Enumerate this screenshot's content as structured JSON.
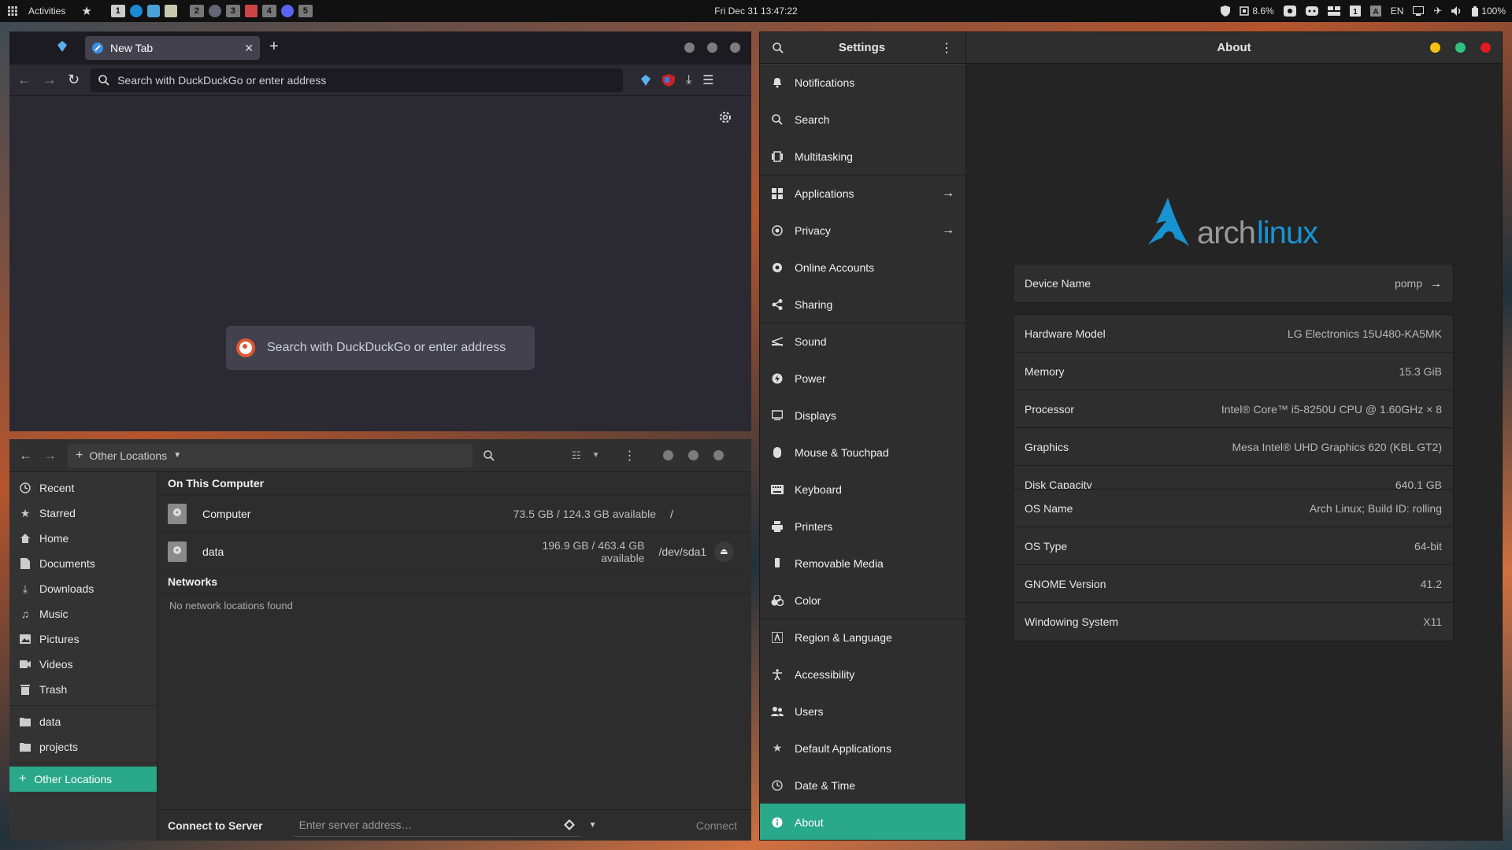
{
  "topbar": {
    "activities": "Activities",
    "workspaces": [
      "1",
      "2",
      "3",
      "4",
      "5"
    ],
    "clock": "Fri Dec 31  13:47:22",
    "cpu": "8.6%",
    "lang": "EN",
    "battery": "100%"
  },
  "browser": {
    "tab_title": "New Tab",
    "url_placeholder": "Search with DuckDuckGo or enter address",
    "center_search": "Search with DuckDuckGo or enter address"
  },
  "files": {
    "path": "Other Locations",
    "sidebar": [
      {
        "label": "Recent",
        "icon": "clock-icon"
      },
      {
        "label": "Starred",
        "icon": "star-icon"
      },
      {
        "label": "Home",
        "icon": "home-icon"
      },
      {
        "label": "Documents",
        "icon": "documents-icon"
      },
      {
        "label": "Downloads",
        "icon": "download-icon"
      },
      {
        "label": "Music",
        "icon": "music-icon"
      },
      {
        "label": "Pictures",
        "icon": "pictures-icon"
      },
      {
        "label": "Videos",
        "icon": "videos-icon"
      },
      {
        "label": "Trash",
        "icon": "trash-icon"
      }
    ],
    "bookmarks": [
      {
        "label": "data",
        "icon": "folder-icon"
      },
      {
        "label": "projects",
        "icon": "folder-icon"
      }
    ],
    "other_locations": "Other Locations",
    "on_this_computer": "On This Computer",
    "drives": [
      {
        "name": "Computer",
        "space": "73.5 GB / 124.3 GB available",
        "mount": "/"
      },
      {
        "name": "data",
        "space": "196.9 GB / 463.4 GB available",
        "mount": "/dev/sda1"
      }
    ],
    "networks": "Networks",
    "no_networks": "No network locations found",
    "connect_label": "Connect to Server",
    "connect_placeholder": "Enter server address…",
    "connect_button": "Connect"
  },
  "settings": {
    "title": "Settings",
    "panel_title": "About",
    "nav": [
      {
        "label": "Notifications",
        "icon": "bell-icon"
      },
      {
        "label": "Search",
        "icon": "search-icon"
      },
      {
        "label": "Multitasking",
        "icon": "multitasking-icon"
      },
      {
        "label": "Applications",
        "icon": "applications-icon",
        "arrow": true
      },
      {
        "label": "Privacy",
        "icon": "privacy-icon",
        "arrow": true
      },
      {
        "label": "Online Accounts",
        "icon": "online-accounts-icon"
      },
      {
        "label": "Sharing",
        "icon": "share-icon"
      },
      {
        "label": "Sound",
        "icon": "sound-icon"
      },
      {
        "label": "Power",
        "icon": "power-icon"
      },
      {
        "label": "Displays",
        "icon": "display-icon"
      },
      {
        "label": "Mouse & Touchpad",
        "icon": "mouse-icon"
      },
      {
        "label": "Keyboard",
        "icon": "keyboard-icon"
      },
      {
        "label": "Printers",
        "icon": "printer-icon"
      },
      {
        "label": "Removable Media",
        "icon": "usb-icon"
      },
      {
        "label": "Color",
        "icon": "color-icon"
      },
      {
        "label": "Region & Language",
        "icon": "region-icon"
      },
      {
        "label": "Accessibility",
        "icon": "accessibility-icon"
      },
      {
        "label": "Users",
        "icon": "users-icon"
      },
      {
        "label": "Default Applications",
        "icon": "star-icon"
      },
      {
        "label": "Date & Time",
        "icon": "clock-icon"
      },
      {
        "label": "About",
        "icon": "info-icon"
      }
    ],
    "logo_text_arch": "arch",
    "logo_text_linux": "linux",
    "device_name_label": "Device Name",
    "device_name_value": "pomp",
    "hardware": [
      {
        "label": "Hardware Model",
        "value": "LG Electronics 15U480-KA5MK"
      },
      {
        "label": "Memory",
        "value": "15.3 GiB"
      },
      {
        "label": "Processor",
        "value": "Intel® Core™ i5-8250U CPU @ 1.60GHz × 8"
      },
      {
        "label": "Graphics",
        "value": "Mesa Intel® UHD Graphics 620 (KBL GT2)"
      },
      {
        "label": "Disk Capacity",
        "value": "640.1 GB"
      }
    ],
    "os": [
      {
        "label": "OS Name",
        "value": "Arch Linux; Build ID: rolling"
      },
      {
        "label": "OS Type",
        "value": "64-bit"
      },
      {
        "label": "GNOME Version",
        "value": "41.2"
      },
      {
        "label": "Windowing System",
        "value": "X11"
      }
    ]
  },
  "colors": {
    "accent": "#2aa88a",
    "arch_blue": "#1793d1",
    "min_btn": "#f5c211",
    "max_btn": "#2ec27e",
    "close_btn": "#e01b24"
  }
}
